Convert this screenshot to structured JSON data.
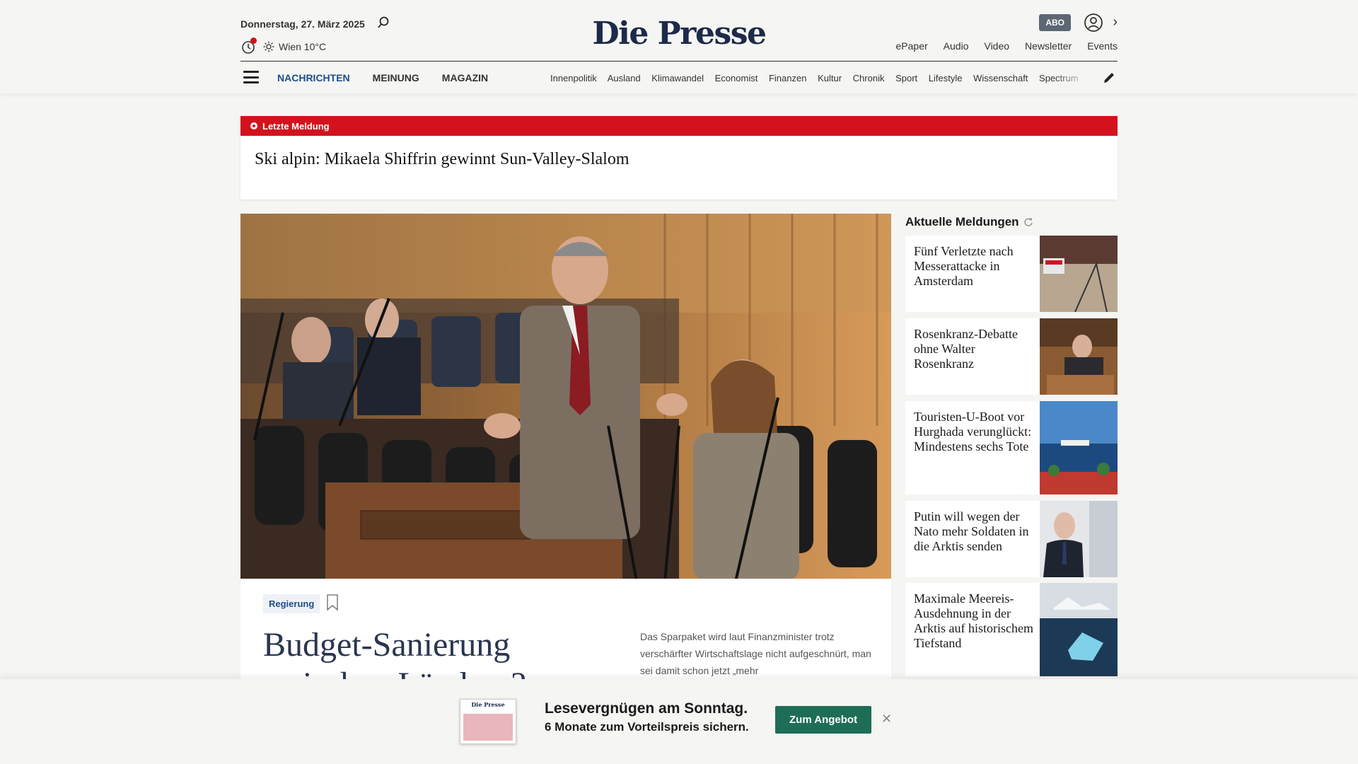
{
  "header": {
    "date": "Donnerstag, 27. März 2025",
    "weather": "Wien 10°C",
    "logo": "Die Presse",
    "abo_label": "ABO",
    "top_links": [
      "ePaper",
      "Audio",
      "Video",
      "Newsletter",
      "Events"
    ],
    "main_nav": [
      {
        "label": "NACHRICHTEN",
        "active": true
      },
      {
        "label": "MEINUNG",
        "active": false
      },
      {
        "label": "MAGAZIN",
        "active": false
      }
    ],
    "sub_nav": [
      "Innenpolitik",
      "Ausland",
      "Klimawandel",
      "Economist",
      "Finanzen",
      "Kultur",
      "Chronik",
      "Sport",
      "Lifestyle",
      "Wissenschaft",
      "Spectrum"
    ],
    "icons": [
      "search-icon",
      "history-icon",
      "sun-icon",
      "user-icon",
      "chevron-right-icon",
      "menu-icon",
      "pen-icon"
    ]
  },
  "breaking": {
    "label": "Letzte Meldung",
    "title": "Ski alpin: Mikaela Shiffrin gewinnt Sun-Valley-Slalom"
  },
  "hero": {
    "tag": "Regierung",
    "title": "Budget-Sanierung zwischen Ländern?",
    "teaser": "Das Sparpaket wird laut Finanzminister trotz verschärfter Wirtschaftslage nicht aufgeschnürt, man sei damit schon jetzt „mehr"
  },
  "sidebar": {
    "heading": "Aktuelle Meldungen",
    "items": [
      {
        "title": "Fünf Verletzte nach Messerattacke in Amsterdam"
      },
      {
        "title": "Rosenkranz-Debatte ohne Walter Rosenkranz"
      },
      {
        "title": "Touristen-U-Boot vor Hurghada verunglückt: Mindestens sechs Tote"
      },
      {
        "title": "Putin will wegen der Nato mehr Soldaten in die Arktis senden"
      },
      {
        "title": "Maximale Meereis-Ausdehnung in der Arktis auf historischem Tiefstand"
      }
    ]
  },
  "promo": {
    "line1": "Lesevergnügen am Sonntag.",
    "line2": "6 Monate zum Vorteilspreis sichern.",
    "button": "Zum Angebot",
    "mini_logo": "Die Presse"
  },
  "colors": {
    "accent_red": "#d4121e",
    "nav_active": "#1d4e89",
    "promo_button": "#1e6d57",
    "logo": "#1d2a4a"
  }
}
